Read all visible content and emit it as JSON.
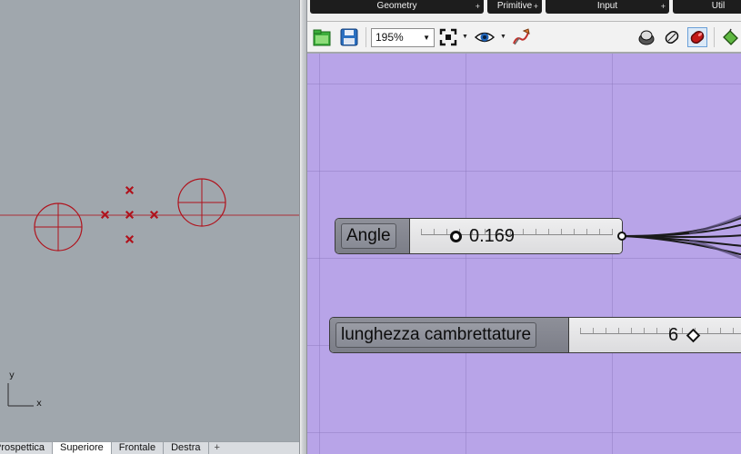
{
  "viewport": {
    "axis_x": "x",
    "axis_y": "y",
    "tabs": [
      {
        "label": "Prospettica",
        "active": false
      },
      {
        "label": "Superiore",
        "active": true
      },
      {
        "label": "Frontale",
        "active": false
      },
      {
        "label": "Destra",
        "active": false
      }
    ],
    "add_tab_symbol": "+",
    "colors": {
      "background": "#a0a7ad",
      "geometry": "#b0121c"
    }
  },
  "grasshopper": {
    "categories": [
      {
        "label": "Geometry"
      },
      {
        "label": "Primitive"
      },
      {
        "label": "Input"
      },
      {
        "label": "Util"
      }
    ],
    "category_arrow": "+",
    "toolbar": {
      "zoom_value": "195%",
      "icons": [
        "open-file-icon",
        "save-file-icon",
        "zoom-extents-icon",
        "preview-eye-icon",
        "sketch-pen-icon",
        "preview-shaded-icon",
        "preview-wireframe-icon",
        "preview-selected-icon",
        "paint-bucket-icon"
      ]
    },
    "canvas": {
      "background": "#b8a4e8",
      "sliders": [
        {
          "label": "Angle",
          "value": "0.169",
          "grip": "circle"
        },
        {
          "label": "lunghezza cambrettature",
          "value": "6",
          "grip": "diamond"
        }
      ]
    }
  }
}
